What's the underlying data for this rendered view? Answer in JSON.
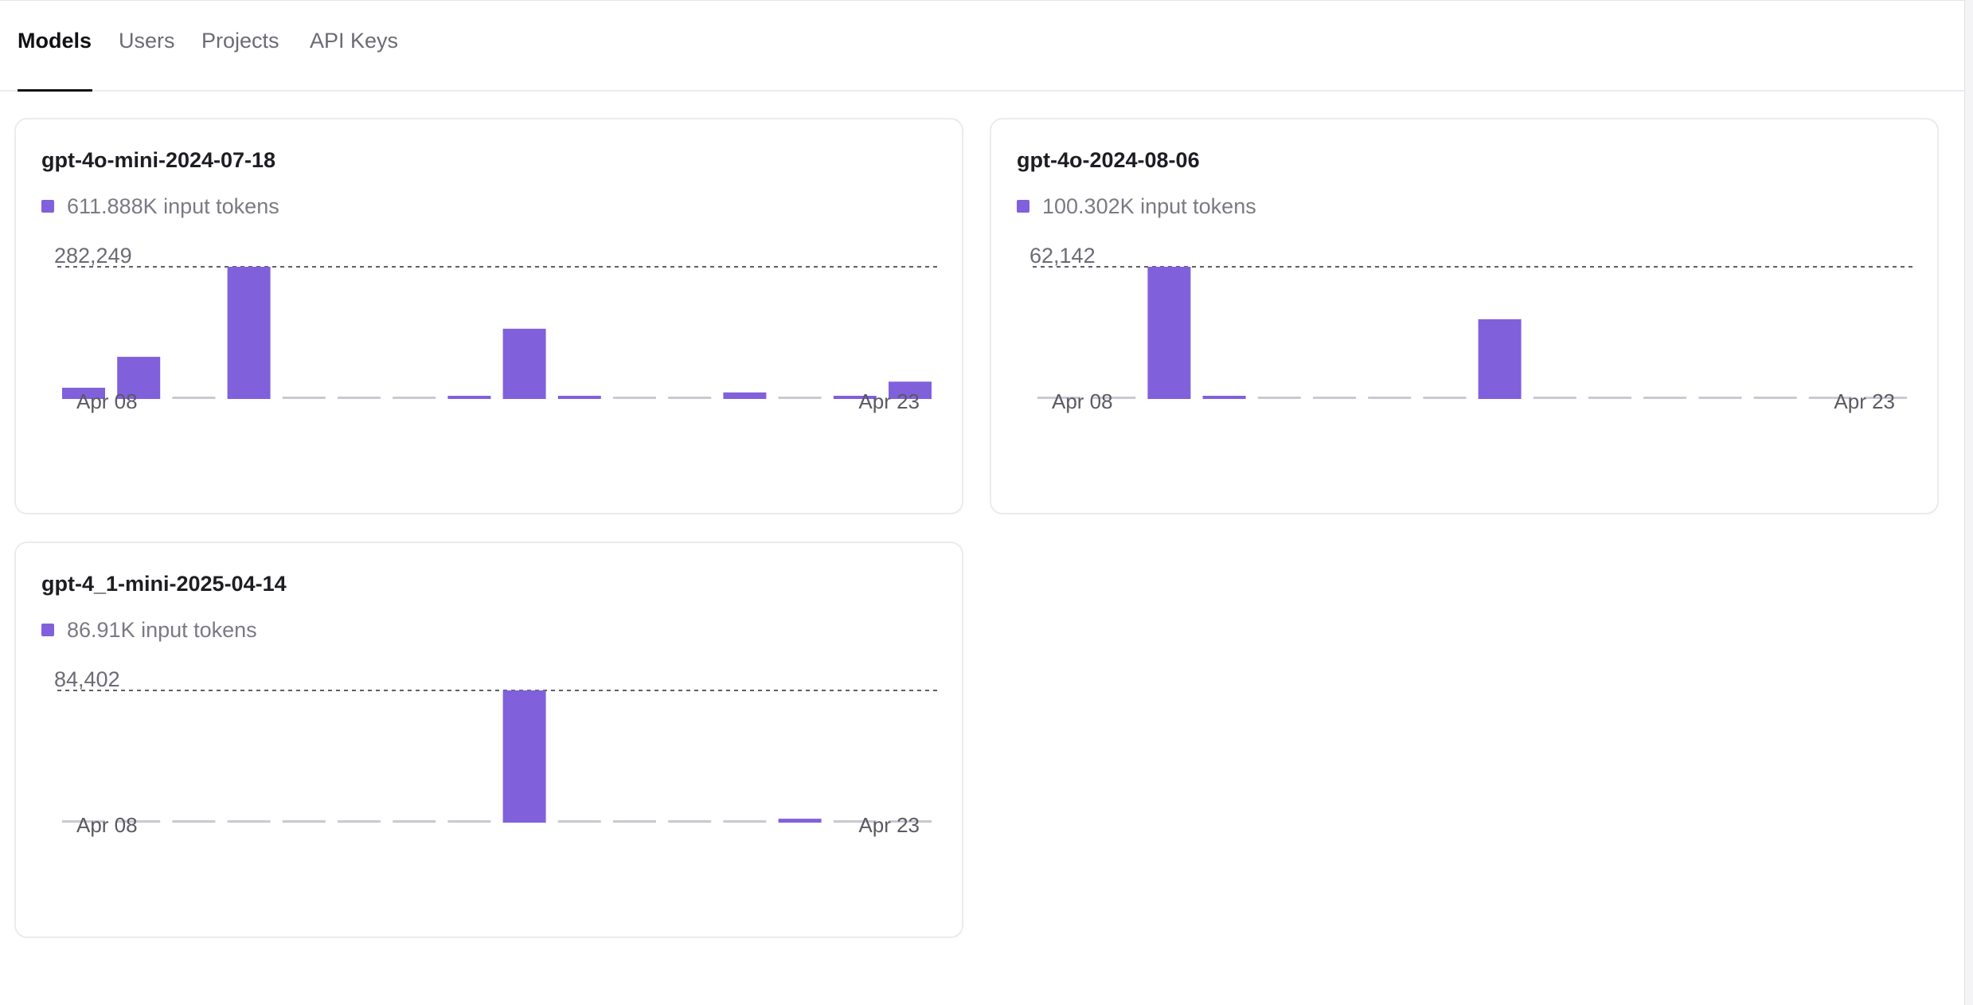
{
  "tabs": [
    {
      "label": "Models",
      "active": true
    },
    {
      "label": "Users",
      "active": false
    },
    {
      "label": "Projects",
      "active": false
    },
    {
      "label": "API Keys",
      "active": false
    }
  ],
  "colors": {
    "bar": "#8160db",
    "empty_bar": "#cbc8d3",
    "dash": "#5f5f66"
  },
  "cards": [
    {
      "title": "gpt-4o-mini-2024-07-18",
      "legend": "611.888K input tokens",
      "chart_data": {
        "type": "bar",
        "series": [
          {
            "name": "input tokens",
            "values": [
              24000,
              90000,
              0,
              282249,
              0,
              0,
              0,
              4000,
              150000,
              6000,
              0,
              0,
              14000,
              0,
              4000,
              37000
            ]
          }
        ],
        "x_tick_labels": [
          "Apr 08",
          "Apr 23"
        ],
        "max_label": "282,249",
        "ylim": [
          0,
          282249
        ]
      }
    },
    {
      "title": "gpt-4o-2024-08-06",
      "legend": "100.302K input tokens",
      "chart_data": {
        "type": "bar",
        "series": [
          {
            "name": "input tokens",
            "values": [
              0,
              0,
              62142,
              1200,
              0,
              0,
              0,
              0,
              37500,
              0,
              0,
              0,
              0,
              0,
              0,
              0
            ]
          }
        ],
        "x_tick_labels": [
          "Apr 08",
          "Apr 23"
        ],
        "max_label": "62,142",
        "ylim": [
          0,
          62142
        ]
      }
    },
    {
      "title": "gpt-4_1-mini-2025-04-14",
      "legend": "86.91K input tokens",
      "chart_data": {
        "type": "bar",
        "series": [
          {
            "name": "input tokens",
            "values": [
              0,
              0,
              0,
              0,
              0,
              0,
              0,
              0,
              84402,
              0,
              0,
              0,
              0,
              2500,
              0,
              0
            ]
          }
        ],
        "x_tick_labels": [
          "Apr 08",
          "Apr 23"
        ],
        "max_label": "84,402",
        "ylim": [
          0,
          84402
        ]
      }
    }
  ]
}
